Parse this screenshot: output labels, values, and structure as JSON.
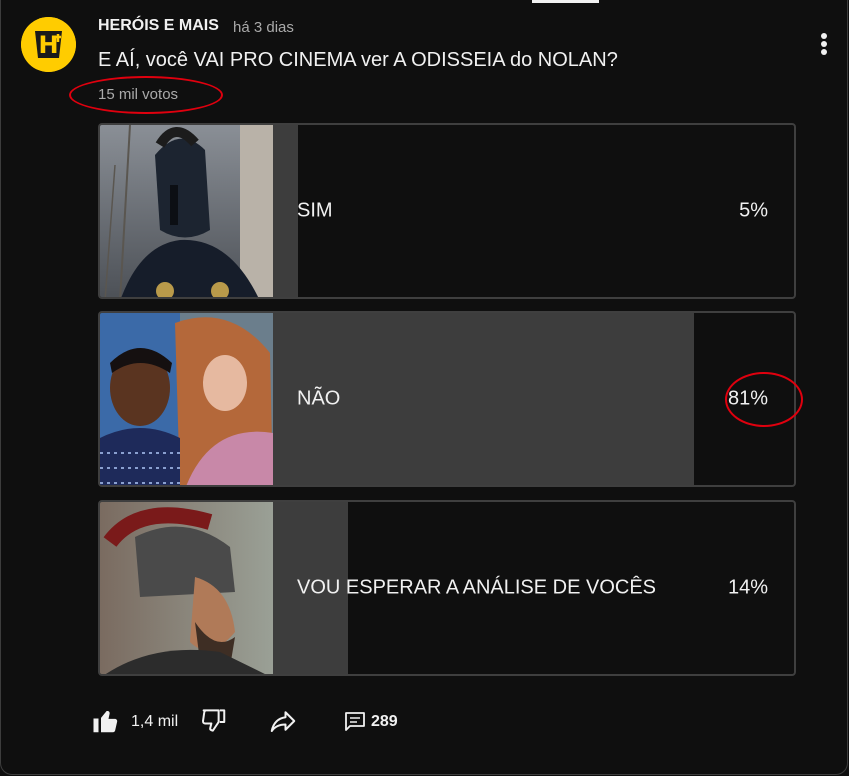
{
  "post": {
    "channel_name": "HERÓIS E MAIS",
    "time_ago": "há 3 dias",
    "question": "E AÍ, você VAI PRO CINEMA ver A ODISSEIA do NOLAN?",
    "votes": "15 mil votos"
  },
  "poll": {
    "options": [
      {
        "label": "SIM",
        "percent_text": "5%",
        "percent": 5,
        "thumbnail": "warrior-helmet-image"
      },
      {
        "label": "NÃO",
        "percent_text": "81%",
        "percent": 81,
        "thumbnail": "two-women-portrait-image"
      },
      {
        "label": "VOU ESPERAR A ANÁLISE DE VOCÊS",
        "percent_text": "14%",
        "percent": 14,
        "thumbnail": "helmeted-soldier-image"
      }
    ]
  },
  "actions": {
    "likes": "1,4 mil",
    "comments": "289"
  },
  "colors": {
    "background": "#0f0f0f",
    "bar": "#3d3d3d",
    "annotation": "#e0000e",
    "avatar": "#ffcc00"
  }
}
